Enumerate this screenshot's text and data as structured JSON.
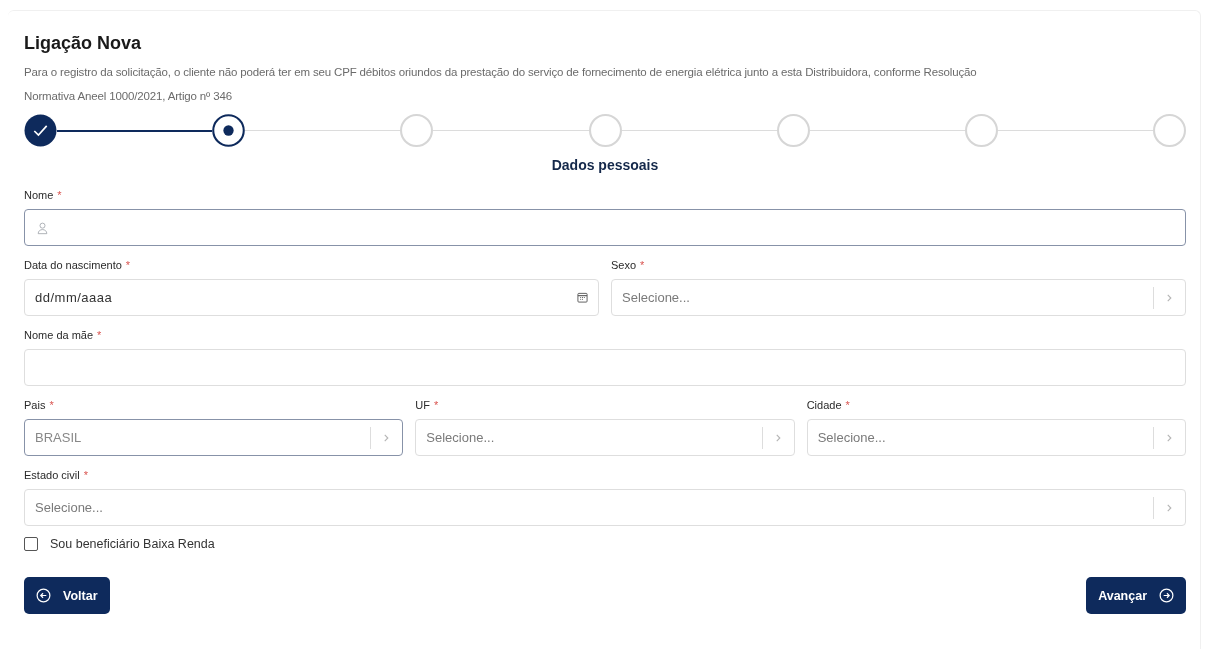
{
  "title": "Ligação Nova",
  "description_lines": [
    "Para o registro da solicitação, o cliente não poderá ter em seu CPF débitos oriundos da prestação do serviço de fornecimento de energia elétrica junto a esta Distribuidora, conforme Resolução",
    "Normativa Aneel 1000/2021, Artigo nº 346"
  ],
  "steps": [
    {
      "completed": true,
      "selected": false
    },
    {
      "completed": false,
      "selected": true
    },
    {
      "completed": false,
      "selected": false
    },
    {
      "completed": false,
      "selected": false
    },
    {
      "completed": false,
      "selected": false
    },
    {
      "completed": false,
      "selected": false
    },
    {
      "completed": false,
      "selected": false
    }
  ],
  "section_title": "Dados pessoais",
  "rows": [
    {
      "fields": [
        {
          "label": "Nome",
          "required_mark": "*",
          "kind": "user",
          "focused": true
        }
      ]
    },
    {
      "fields": [
        {
          "label": "Data do nascimento",
          "required_mark": "*",
          "kind": "date",
          "placeholder": "dd/mm/aaaa",
          "focused": false
        },
        {
          "label": "Sexo",
          "required_mark": "*",
          "kind": "select",
          "placeholder": "Selecione...",
          "focused": false
        }
      ]
    },
    {
      "fields": [
        {
          "label": "Nome da mãe",
          "required_mark": "*",
          "kind": "text",
          "focused": false
        }
      ]
    },
    {
      "fields": [
        {
          "label": "Pais",
          "required_mark": "*",
          "kind": "select",
          "value": "BRASIL",
          "focused": true
        },
        {
          "label": "UF",
          "required_mark": "*",
          "kind": "select",
          "placeholder": "Selecione...",
          "focused": false
        },
        {
          "label": "Cidade",
          "required_mark": "*",
          "kind": "select",
          "placeholder": "Selecione...",
          "focused": false
        }
      ]
    },
    {
      "fields": [
        {
          "label": "Estado civil",
          "required_mark": "*",
          "kind": "select",
          "placeholder": "Selecione...",
          "focused": false
        }
      ]
    }
  ],
  "checkbox": {
    "label": "Sou beneficiário Baixa Renda",
    "checked": false
  },
  "back_button": "Voltar",
  "next_button": "Avançar"
}
